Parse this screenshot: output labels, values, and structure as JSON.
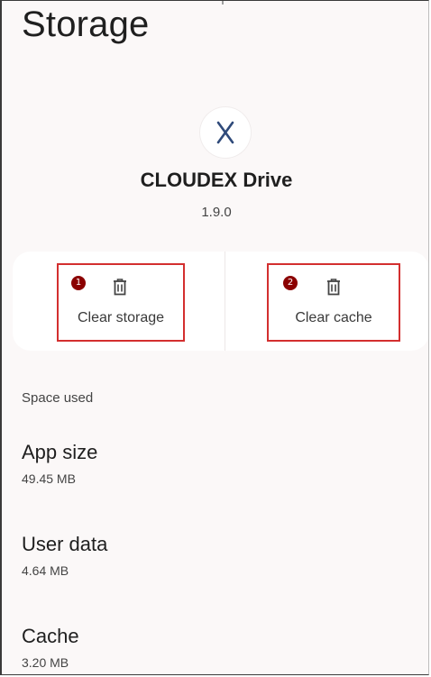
{
  "page": {
    "title": "Storage"
  },
  "app": {
    "icon": "cloudex-x-logo-icon",
    "name": "CLOUDEX Drive",
    "version": "1.9.0"
  },
  "actions": {
    "clear_storage": {
      "badge": "1",
      "label": "Clear storage",
      "icon": "trash-icon"
    },
    "clear_cache": {
      "badge": "2",
      "label": "Clear cache",
      "icon": "trash-icon"
    }
  },
  "space_used": {
    "label": "Space used",
    "app_size": {
      "title": "App size",
      "value": "49.45 MB"
    },
    "user_data": {
      "title": "User data",
      "value": "4.64 MB"
    },
    "cache": {
      "title": "Cache",
      "value": "3.20 MB"
    }
  },
  "colors": {
    "highlight_border": "#d32f2f",
    "badge": "#8b0000",
    "logo": "#2f4a7a"
  }
}
